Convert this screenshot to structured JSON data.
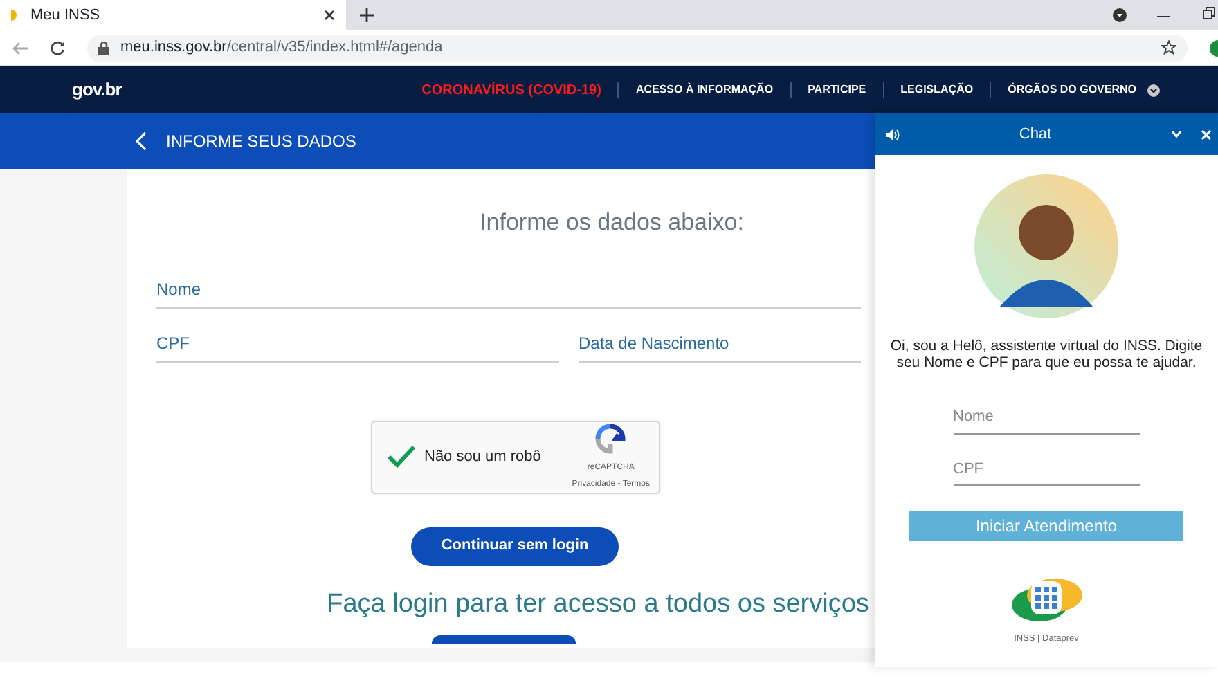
{
  "browser": {
    "tab": {
      "title": "Meu INSS"
    },
    "url": {
      "host": "meu.inss.gov.br",
      "path": "/central/v35/index.html#/agenda"
    }
  },
  "govbar": {
    "logo": "gov.br",
    "links": [
      {
        "label": "CORONAVÍRUS (COVID-19)",
        "kind": "alert"
      },
      {
        "label": "ACESSO À INFORMAÇÃO",
        "kind": "normal"
      },
      {
        "label": "PARTICIPE",
        "kind": "normal"
      },
      {
        "label": "LEGISLAÇÃO",
        "kind": "normal"
      },
      {
        "label": "ÓRGÃOS DO GOVERNO",
        "kind": "dropdown"
      }
    ]
  },
  "header": {
    "title": "INFORME SEUS DADOS"
  },
  "form": {
    "heading": "Informe os dados abaixo:",
    "fields": [
      {
        "placeholder": "Nome"
      },
      {
        "placeholder": "CPF"
      },
      {
        "placeholder": "Data de Nascimento"
      }
    ],
    "captcha": {
      "label": "Não sou um robô",
      "checked": true,
      "brand": "reCAPTCHA",
      "links": "Privacidade - Termos"
    },
    "continue_button": "Continuar sem login",
    "login_prompt": "Faça login para ter acesso a todos os serviços"
  },
  "chat": {
    "title": "Chat",
    "greeting": "Oi, sou a Helô, assistente virtual do INSS. Digite seu Nome e CPF para que eu possa te ajudar.",
    "fields": [
      {
        "placeholder": "Nome"
      },
      {
        "placeholder": "CPF"
      }
    ],
    "start_button": "Iniciar Atendimento",
    "footer": "INSS | Dataprev"
  }
}
